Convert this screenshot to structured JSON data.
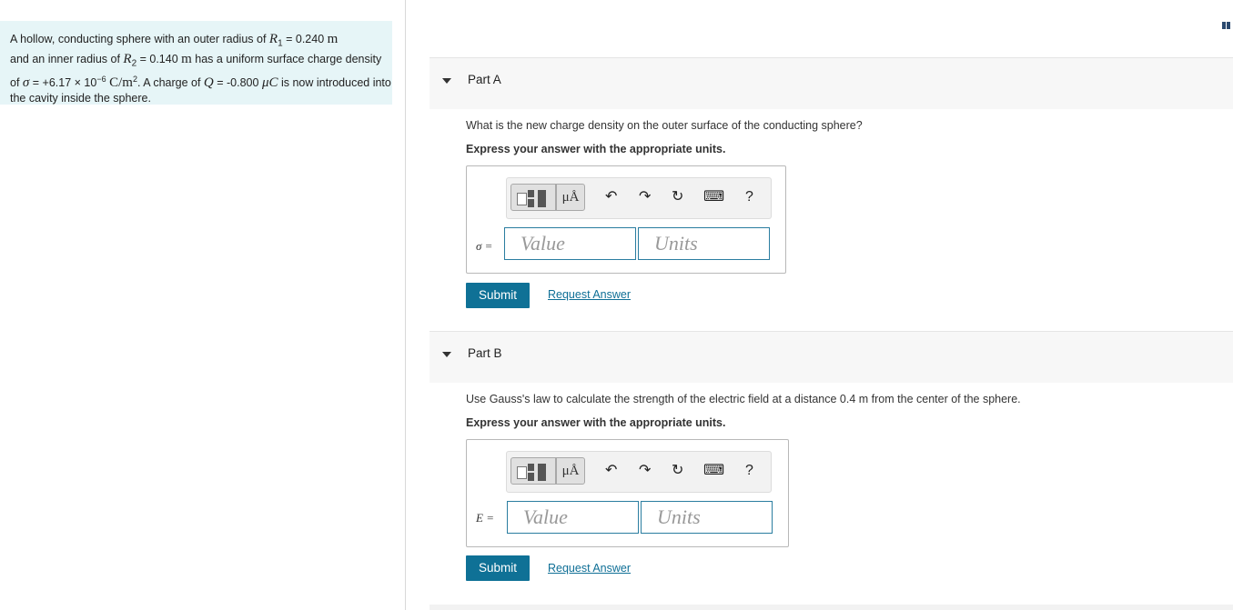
{
  "problem": {
    "t1": "A hollow, conducting sphere with an outer radius of ",
    "r1_sym": "R",
    "r1_sub": "1",
    "r1_val": " = 0.240 ",
    "unit_m1": "m",
    "t2": "and an inner radius of ",
    "r2_sym": "R",
    "r2_sub": "2",
    "r2_val": " = 0.140 ",
    "unit_m2": "m",
    "t3": " has a uniform surface charge density of ",
    "sigma_sym": "σ",
    "sigma_val": " = +6.17 × 10",
    "sigma_exp": "−6",
    "sigma_unit": "C/m",
    "sigma_unit_exp": "2",
    "t4": ". A charge of ",
    "q_sym": "Q",
    "q_val": " = -0.800 ",
    "q_unit": "μC",
    "t5": " is now introduced into the cavity inside the sphere."
  },
  "partA": {
    "title": "Part A",
    "question": "What is the new charge density on the outer surface of the conducting sphere?",
    "instruction": "Express your answer with the appropriate units.",
    "var_label": "σ =",
    "value_placeholder": "Value",
    "units_placeholder": "Units",
    "units_btn": "μÅ",
    "submit": "Submit",
    "request": "Request Answer"
  },
  "partB": {
    "title": "Part B",
    "question": "Use Gauss's law to calculate the strength of the electric field at a distance  0.4  m from the center of  the sphere.",
    "instruction": "Express your answer with the appropriate units.",
    "var_label": "E =",
    "value_placeholder": "Value",
    "units_placeholder": "Units",
    "units_btn": "μÅ",
    "submit": "Submit",
    "request": "Request Answer"
  },
  "toolbar_icons": {
    "undo": "↶",
    "redo": "↷",
    "reset": "↻",
    "keyboard": "⌨",
    "help": "?"
  },
  "colors": {
    "accent": "#0f7196",
    "problem_bg": "#e6f5f7",
    "input_border": "#2a7da0"
  }
}
